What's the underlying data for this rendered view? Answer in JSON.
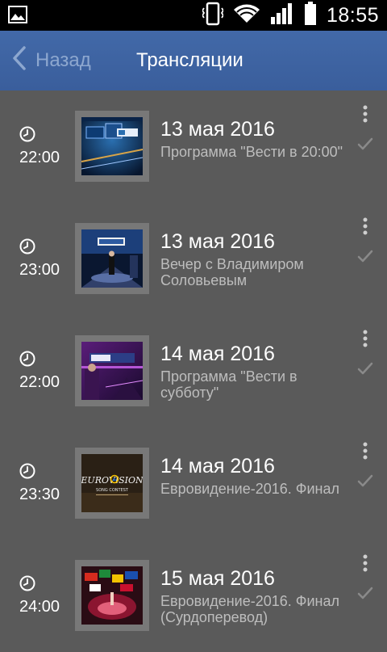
{
  "status_bar": {
    "time": "18:55",
    "icons": [
      "gallery-icon",
      "vibrate-icon",
      "wifi-icon",
      "signal-icon",
      "battery-icon"
    ]
  },
  "header": {
    "back_label": "Назад",
    "title": "Трансляции",
    "background_color": "#3d62a2"
  },
  "broadcasts": [
    {
      "time": "22:00",
      "date": "13 мая 2016",
      "title": "Программа \"Вести в 20:00\"",
      "thumbnail": "vesti-studio-thumb"
    },
    {
      "time": "23:00",
      "date": "13 мая 2016",
      "title": "Вечер с Владимиром Соловьевым",
      "thumbnail": "vecher-studio-thumb"
    },
    {
      "time": "22:00",
      "date": "14 мая 2016",
      "title": "Программа \"Вести в субботу\"",
      "thumbnail": "vesti-subbota-thumb"
    },
    {
      "time": "23:30",
      "date": "14 мая 2016",
      "title": "Евровидение-2016. Финал",
      "thumbnail": "eurovision-logo-thumb"
    },
    {
      "time": "24:00",
      "date": "15 мая 2016",
      "title": "Евровидение-2016. Финал (Сурдоперевод)",
      "thumbnail": "eurovision-flags-thumb"
    }
  ],
  "eurovision_logo": {
    "line1": "EUROVISION",
    "line2": "SONG CONTEST"
  }
}
